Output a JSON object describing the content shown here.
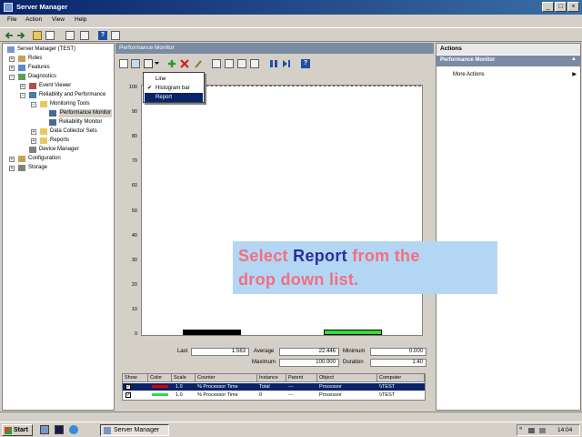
{
  "window": {
    "title": "Server Manager",
    "minimize": "_",
    "maximize": "□",
    "close": "×"
  },
  "menu": [
    "File",
    "Action",
    "View",
    "Help"
  ],
  "toolbar": {
    "back_icon": "arrow-left-icon",
    "forward_icon": "arrow-right-icon",
    "help_label": "?"
  },
  "tree": {
    "root": "Server Manager (TEST)",
    "roles": "Roles",
    "features": "Features",
    "diagnostics": "Diagnostics",
    "event_viewer": "Event Viewer",
    "reliability": "Reliability and Performance",
    "monitoring_tools": "Monitoring Tools",
    "performance_monitor": "Performance Monitor",
    "reliability_monitor": "Reliability Monitor",
    "data_collector_sets": "Data Collector Sets",
    "reports": "Reports",
    "device_manager": "Device Manager",
    "configuration": "Configuration",
    "storage": "Storage"
  },
  "center": {
    "title": "Performance Monitor"
  },
  "dropdown": {
    "items": [
      "Line",
      "Histogram bar",
      "Report"
    ],
    "checked": "Histogram bar",
    "highlighted": "Report"
  },
  "graph": {
    "y_ticks": [
      "100",
      "90",
      "80",
      "70",
      "60",
      "50",
      "40",
      "30",
      "20",
      "10",
      "0"
    ],
    "series_colors": [
      "#000000",
      "#33dd33"
    ],
    "bar_levels": [
      0.0,
      0.0
    ]
  },
  "stats": {
    "last_label": "Last",
    "last_value": "1.563",
    "average_label": "Average",
    "average_value": "22.446",
    "minimum_label": "Minimum",
    "minimum_value": "0.000",
    "maximum_label": "Maximum",
    "maximum_value": "100.000",
    "duration_label": "Duration",
    "duration_value": "1:40"
  },
  "counters": {
    "headers": [
      "Show",
      "Color",
      "Scale",
      "Counter",
      "Instance",
      "Parent",
      "Object",
      "Computer"
    ],
    "rows": [
      {
        "scale": "1.0",
        "counter": "% Processor Time",
        "instance": "Total",
        "parent": "---",
        "object": "Processor",
        "computer": "\\\\TEST",
        "color": "#dd0000",
        "selected": true
      },
      {
        "scale": "1.0",
        "counter": "% Processor Time",
        "instance": "0",
        "parent": "---",
        "object": "Processor",
        "computer": "\\\\TEST",
        "color": "#33dd33",
        "selected": false
      }
    ]
  },
  "actions": {
    "title": "Actions",
    "section": "Performance Monitor",
    "more": "More Actions"
  },
  "callout": {
    "line1_a": "Select ",
    "line1_b": "Report",
    "line1_c": " from the",
    "line2": "drop down list."
  },
  "taskbar": {
    "start": "Start",
    "task": "Server Manager",
    "clock": "14:04"
  }
}
